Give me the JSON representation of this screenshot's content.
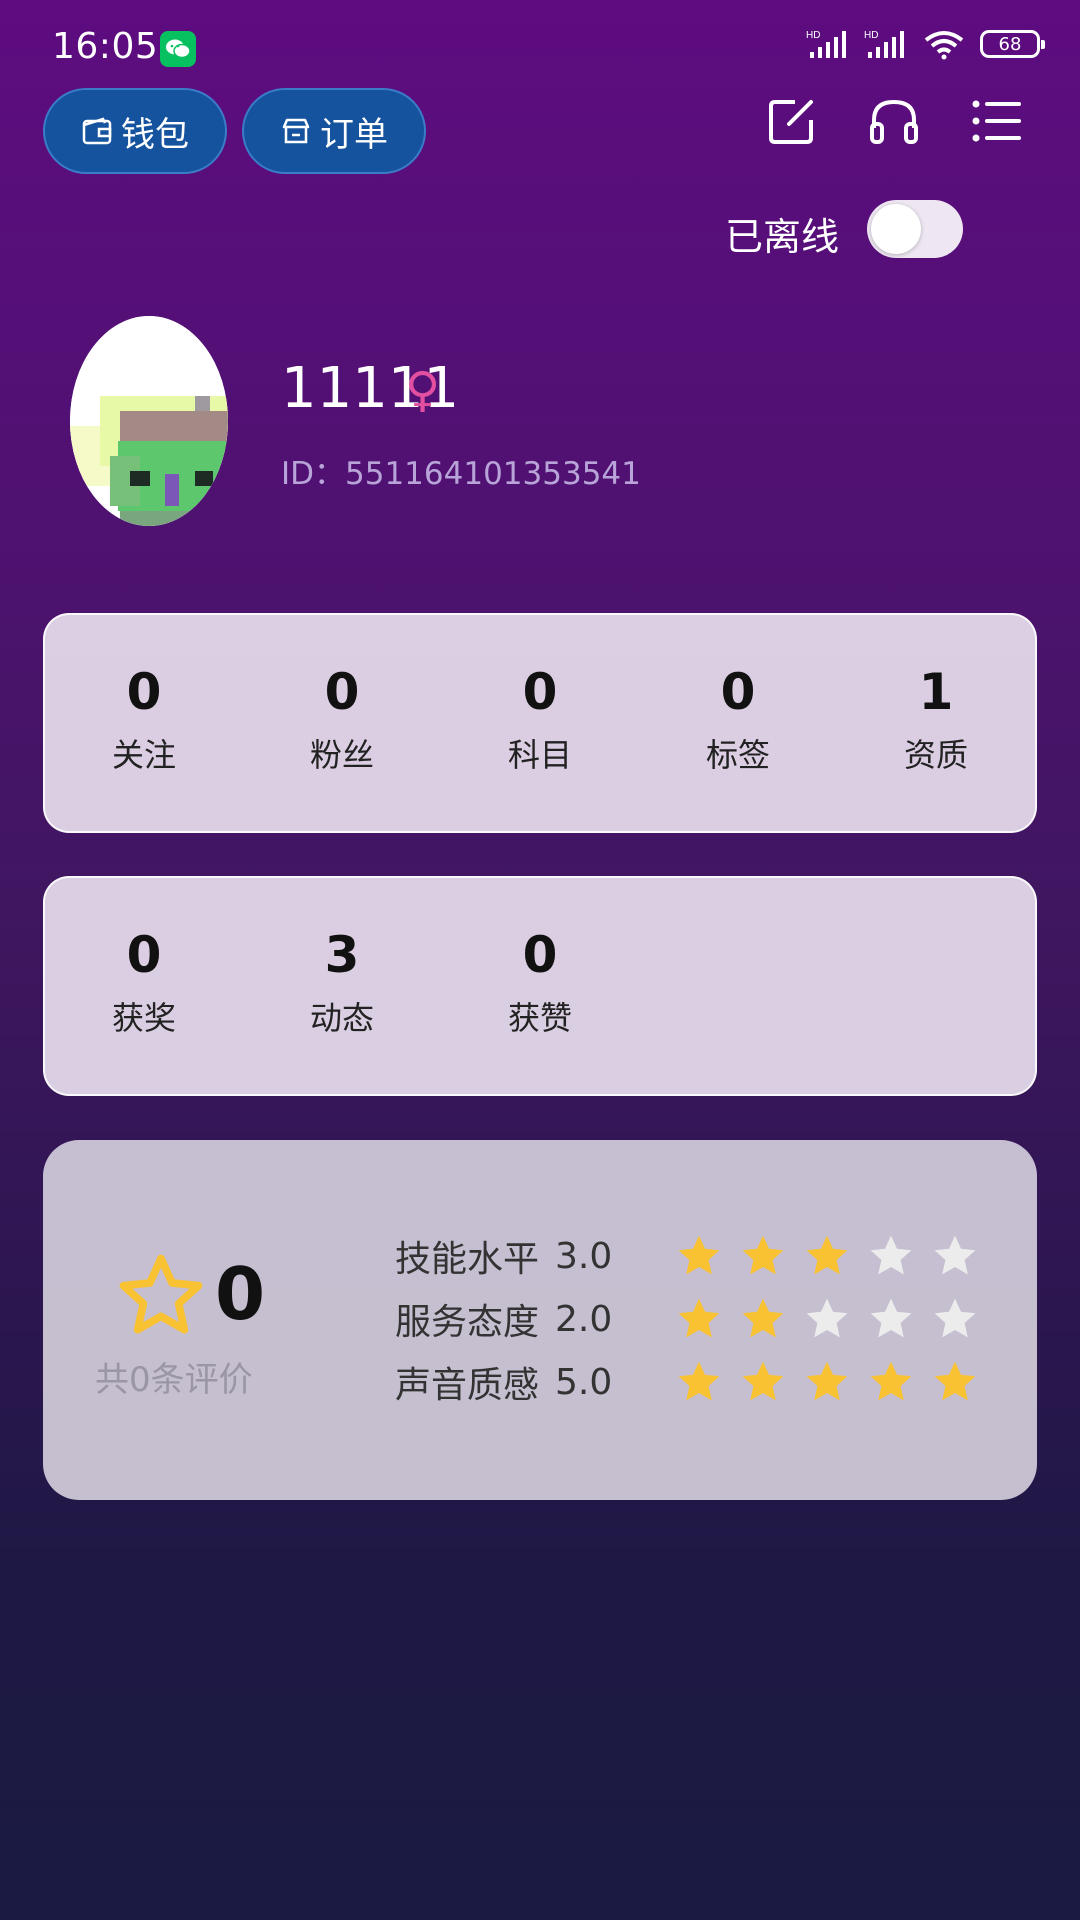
{
  "status_bar": {
    "time": "16:05",
    "battery": "68"
  },
  "top_actions": {
    "wallet_label": "钱包",
    "orders_label": "订单"
  },
  "online_status": {
    "label": "已离线",
    "enabled": false
  },
  "profile": {
    "username": "11111",
    "gender_symbol": "♀",
    "id_text": "ID：551164101353541"
  },
  "stats_primary": [
    {
      "value": "0",
      "label": "关注"
    },
    {
      "value": "0",
      "label": "粉丝"
    },
    {
      "value": "0",
      "label": "科目"
    },
    {
      "value": "0",
      "label": "标签"
    },
    {
      "value": "1",
      "label": "资质"
    }
  ],
  "stats_secondary": [
    {
      "value": "0",
      "label": "获奖"
    },
    {
      "value": "3",
      "label": "动态"
    },
    {
      "value": "0",
      "label": "获赞"
    }
  ],
  "rating": {
    "score": "0",
    "review_count_text": "共0条评价",
    "items": [
      {
        "label": "技能水平",
        "value": "3.0",
        "stars": 3
      },
      {
        "label": "服务态度",
        "value": "2.0",
        "stars": 2
      },
      {
        "label": "声音质感",
        "value": "5.0",
        "stars": 5
      }
    ],
    "max_stars": 5,
    "star_color_filled": "#f9c232",
    "star_color_empty": "#ececec"
  }
}
